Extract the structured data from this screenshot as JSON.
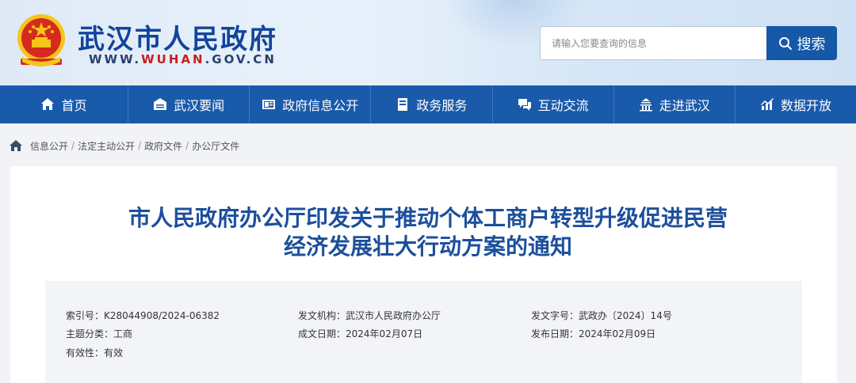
{
  "header": {
    "site_title": "武汉市人民政府",
    "site_url_prefix": "WWW.",
    "site_url_highlight": "WUHAN",
    "site_url_suffix": ".GOV.CN",
    "search_placeholder": "请输入您要查询的信息",
    "search_button": "搜索"
  },
  "nav": {
    "items": [
      {
        "label": "首页",
        "icon": "home-icon"
      },
      {
        "label": "武汉要闻",
        "icon": "news-icon"
      },
      {
        "label": "政府信息公开",
        "icon": "info-icon"
      },
      {
        "label": "政务服务",
        "icon": "service-icon"
      },
      {
        "label": "互动交流",
        "icon": "chat-icon"
      },
      {
        "label": "走进武汉",
        "icon": "city-icon"
      },
      {
        "label": "数据开放",
        "icon": "chart-icon"
      }
    ]
  },
  "breadcrumb": {
    "items": [
      "信息公开",
      "法定主动公开",
      "政府文件",
      "办公厅文件"
    ],
    "separator": "/"
  },
  "article": {
    "title_line1": "市人民政府办公厅印发关于推动个体工商户转型升级促进民营",
    "title_line2": "经济发展壮大行动方案的通知"
  },
  "meta": {
    "index_label": "索引号：",
    "index_value": "K28044908/2024-06382",
    "issuer_label": "发文机构：",
    "issuer_value": "武汉市人民政府办公厅",
    "doc_no_label": "发文字号：",
    "doc_no_value": "武政办〔2024〕14号",
    "category_label": "主题分类：",
    "category_value": "工商",
    "written_label": "成文日期：",
    "written_value": "2024年02月07日",
    "published_label": "发布日期：",
    "published_value": "2024年02月09日",
    "validity_label": "有效性：",
    "validity_value": "有效"
  },
  "colors": {
    "brand_blue": "#1a5aab",
    "title_blue": "#1c4f9c",
    "emblem_red": "#d52b1e",
    "emblem_gold": "#f5c518"
  }
}
